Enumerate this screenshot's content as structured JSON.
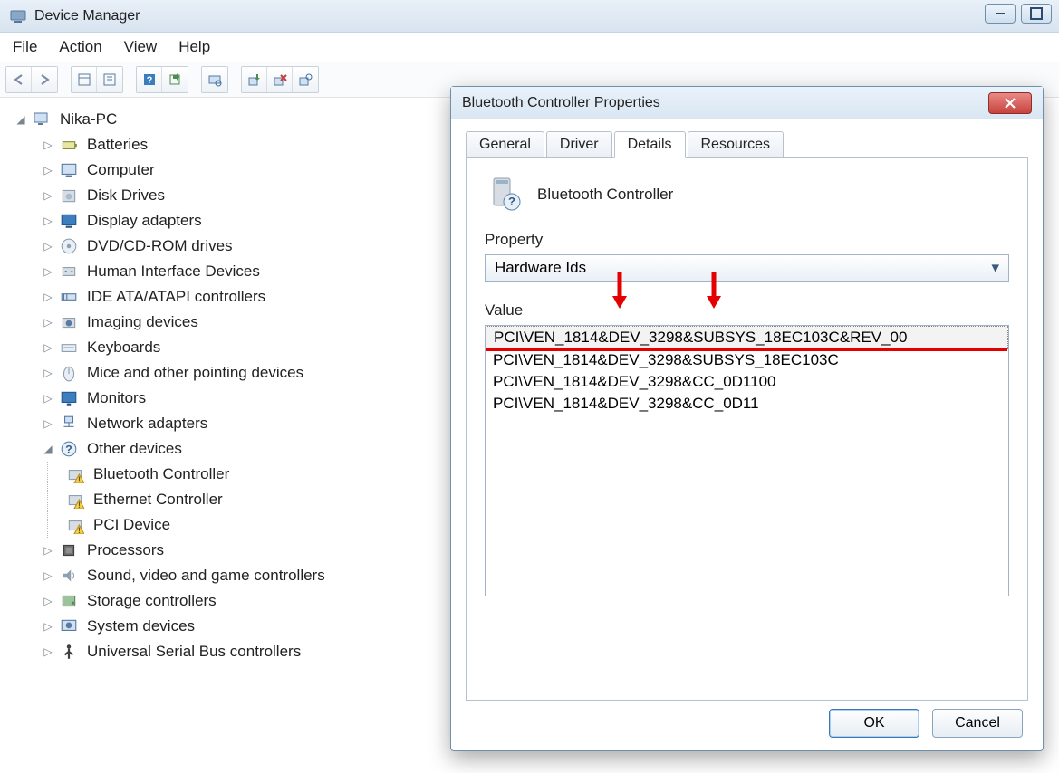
{
  "window": {
    "title": "Device Manager",
    "menus": [
      "File",
      "Action",
      "View",
      "Help"
    ]
  },
  "tree": {
    "root": "Nika-PC",
    "items": [
      {
        "label": "Batteries",
        "icon": "battery"
      },
      {
        "label": "Computer",
        "icon": "computer"
      },
      {
        "label": "Disk Drives",
        "icon": "disk"
      },
      {
        "label": "Display adapters",
        "icon": "display"
      },
      {
        "label": "DVD/CD-ROM drives",
        "icon": "dvd"
      },
      {
        "label": "Human Interface Devices",
        "icon": "hid"
      },
      {
        "label": "IDE ATA/ATAPI controllers",
        "icon": "ide"
      },
      {
        "label": "Imaging devices",
        "icon": "imaging"
      },
      {
        "label": "Keyboards",
        "icon": "keyboard"
      },
      {
        "label": "Mice and other pointing devices",
        "icon": "mouse"
      },
      {
        "label": "Monitors",
        "icon": "monitor"
      },
      {
        "label": "Network adapters",
        "icon": "network"
      },
      {
        "label": "Other devices",
        "icon": "unknown",
        "expanded": true,
        "children": [
          {
            "label": "Bluetooth Controller",
            "icon": "warn"
          },
          {
            "label": "Ethernet Controller",
            "icon": "warn"
          },
          {
            "label": "PCI Device",
            "icon": "warn"
          }
        ]
      },
      {
        "label": "Processors",
        "icon": "cpu"
      },
      {
        "label": "Sound, video and game controllers",
        "icon": "sound"
      },
      {
        "label": "Storage controllers",
        "icon": "storage"
      },
      {
        "label": "System devices",
        "icon": "system"
      },
      {
        "label": "Universal Serial Bus controllers",
        "icon": "usb"
      }
    ]
  },
  "dialog": {
    "title": "Bluetooth Controller Properties",
    "tabs": [
      "General",
      "Driver",
      "Details",
      "Resources"
    ],
    "activeTab": "Details",
    "device_name": "Bluetooth Controller",
    "property_label": "Property",
    "property_value": "Hardware Ids",
    "value_label": "Value",
    "values": [
      "PCI\\VEN_1814&DEV_3298&SUBSYS_18EC103C&REV_00",
      "PCI\\VEN_1814&DEV_3298&SUBSYS_18EC103C",
      "PCI\\VEN_1814&DEV_3298&CC_0D1100",
      "PCI\\VEN_1814&DEV_3298&CC_0D11"
    ],
    "buttons": {
      "ok": "OK",
      "cancel": "Cancel"
    }
  }
}
